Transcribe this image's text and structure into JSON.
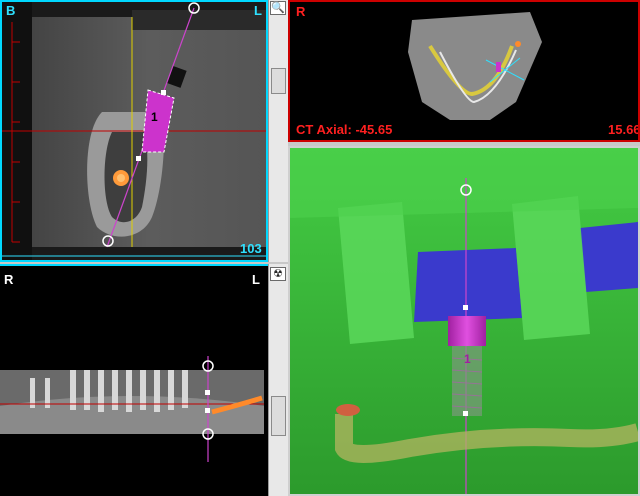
{
  "sagittal": {
    "corner_left": "B",
    "corner_right": "L",
    "slice_number": "103",
    "implant_number": "1"
  },
  "panoramic": {
    "corner_left": "R",
    "corner_right": "L"
  },
  "axial": {
    "corner_left": "R",
    "label": "CT Axial: -45.65",
    "right_value": "15.66"
  },
  "render3d": {
    "implant_number": "1"
  },
  "icons": {
    "zoom": "magnifier-icon",
    "radiation": "radiation-icon"
  },
  "colors": {
    "cyan_border": "#00e5ff",
    "red_border": "#cc0000",
    "implant": "#cc33cc",
    "bone": "#38c838",
    "nerve": "#ff8c2a",
    "label_red": "#ff2020",
    "number_cyan": "#2ee0ff"
  }
}
